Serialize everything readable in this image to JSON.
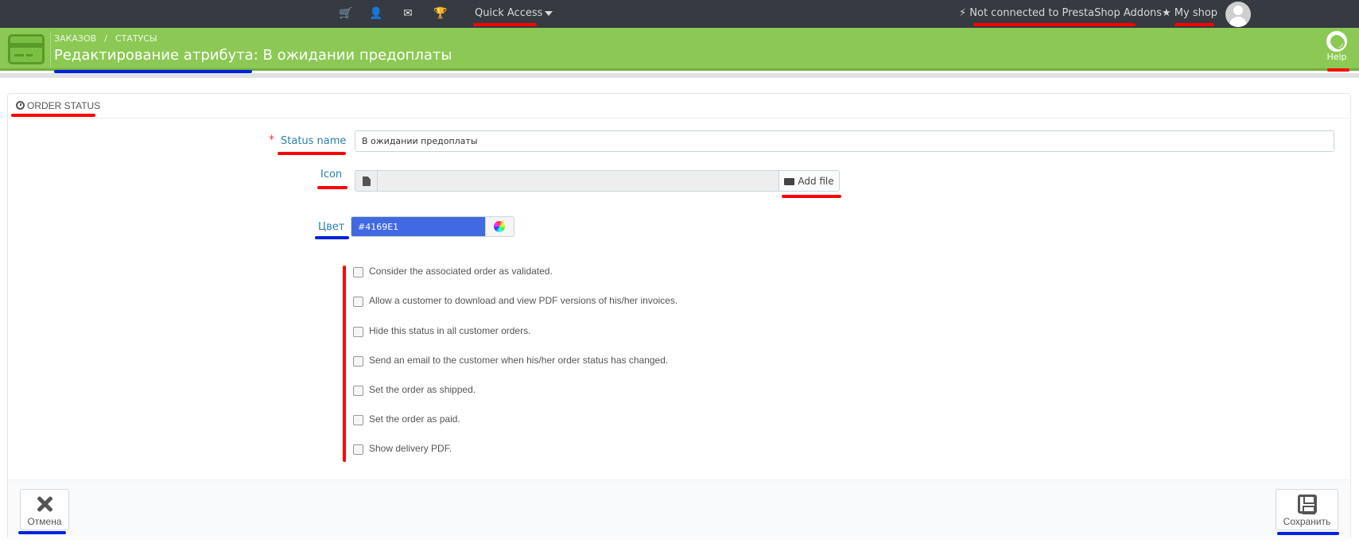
{
  "topbar": {
    "icons": [
      "cart-icon",
      "user-icon",
      "envelope-icon",
      "trophy-icon"
    ],
    "quick_access": "Quick Access",
    "addons_status": "Not connected to PrestaShop Addons",
    "shop": "My shop"
  },
  "header": {
    "breadcrumb": [
      "ЗАКАЗОВ",
      "СТАТУСЫ"
    ],
    "title": "Редактирование атрибута: В ожидании предоплаты",
    "help": "Help"
  },
  "panel": {
    "title": "ORDER STATUS"
  },
  "form": {
    "status_name_label": "Status name",
    "status_name_value": "В ожидании предоплаты",
    "icon_label": "Icon",
    "add_file_label": "Add file",
    "color_label": "Цвет",
    "color_value": "#4169E1",
    "checkboxes": [
      {
        "label": "Consider the associated order as validated.",
        "checked": false
      },
      {
        "label": "Allow a customer to download and view PDF versions of his/her invoices.",
        "checked": false
      },
      {
        "label": "Hide this status in all customer orders.",
        "checked": false
      },
      {
        "label": "Send an email to the customer when his/her order status has changed.",
        "checked": false
      },
      {
        "label": "Set the order as shipped.",
        "checked": false
      },
      {
        "label": "Set the order as paid.",
        "checked": false
      },
      {
        "label": "Show delivery PDF.",
        "checked": false
      }
    ]
  },
  "footer": {
    "cancel_label": "Отмена",
    "save_label": "Сохранить"
  },
  "colors": {
    "topbar": "#363a41",
    "header": "#8bc954",
    "color_swatch": "#4169E1",
    "annotation_red": "#ff0000",
    "annotation_blue": "#0022dd"
  }
}
